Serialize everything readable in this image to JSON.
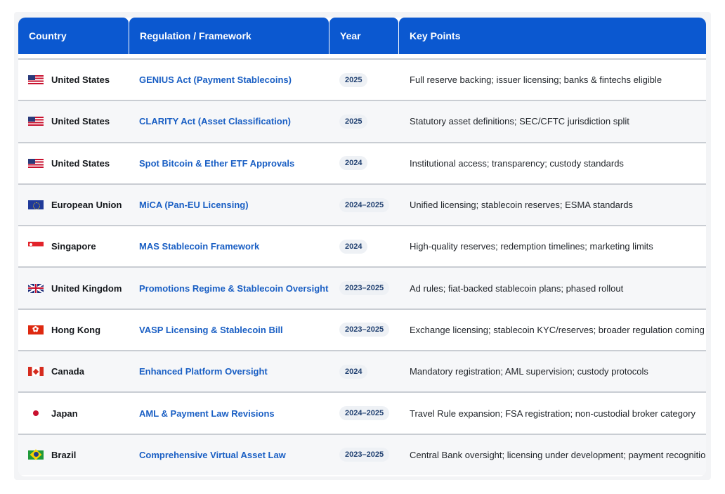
{
  "table": {
    "headers": {
      "country": "Country",
      "regulation": "Regulation / Framework",
      "year": "Year",
      "key_points": "Key Points"
    },
    "rows": [
      {
        "flag": "us-flag-icon",
        "country": "United States",
        "regulation": "GENIUS Act (Payment Stablecoins)",
        "year": "2025",
        "key_points": "Full reserve backing; issuer licensing; banks & fintechs eligible"
      },
      {
        "flag": "us-flag-icon",
        "country": "United States",
        "regulation": "CLARITY Act (Asset Classification)",
        "year": "2025",
        "key_points": "Statutory asset definitions; SEC/CFTC jurisdiction split"
      },
      {
        "flag": "us-flag-icon",
        "country": "United States",
        "regulation": "Spot Bitcoin & Ether ETF Approvals",
        "year": "2024",
        "key_points": "Institutional access; transparency; custody standards"
      },
      {
        "flag": "eu-flag-icon",
        "country": "European Union",
        "regulation": "MiCA (Pan-EU Licensing)",
        "year": "2024–2025",
        "key_points": "Unified licensing; stablecoin reserves; ESMA standards"
      },
      {
        "flag": "sg-flag-icon",
        "country": "Singapore",
        "regulation": "MAS Stablecoin Framework",
        "year": "2024",
        "key_points": "High-quality reserves; redemption timelines; marketing limits"
      },
      {
        "flag": "uk-flag-icon",
        "country": "United Kingdom",
        "regulation": "Promotions Regime & Stablecoin Oversight",
        "year": "2023–2025",
        "key_points": "Ad rules; fiat-backed stablecoin plans; phased rollout"
      },
      {
        "flag": "hk-flag-icon",
        "country": "Hong Kong",
        "regulation": "VASP Licensing & Stablecoin Bill",
        "year": "2023–2025",
        "key_points": "Exchange licensing; stablecoin KYC/reserves; broader regulation coming"
      },
      {
        "flag": "ca-flag-icon",
        "country": "Canada",
        "regulation": "Enhanced Platform Oversight",
        "year": "2024",
        "key_points": "Mandatory registration; AML supervision; custody protocols"
      },
      {
        "flag": "jp-flag-icon",
        "country": "Japan",
        "regulation": "AML & Payment Law Revisions",
        "year": "2024–2025",
        "key_points": "Travel Rule expansion; FSA registration; non-custodial broker category"
      },
      {
        "flag": "br-flag-icon",
        "country": "Brazil",
        "regulation": "Comprehensive Virtual Asset Law",
        "year": "2023–2025",
        "key_points": "Central Bank oversight; licensing under development; payment recognition"
      }
    ]
  },
  "colors": {
    "header_bg": "#0b58d0",
    "header_text": "#ffffff",
    "regulation_link": "#1a5fc4",
    "year_pill_bg": "#eef1f5",
    "row_divider": "#c9cdd3"
  }
}
